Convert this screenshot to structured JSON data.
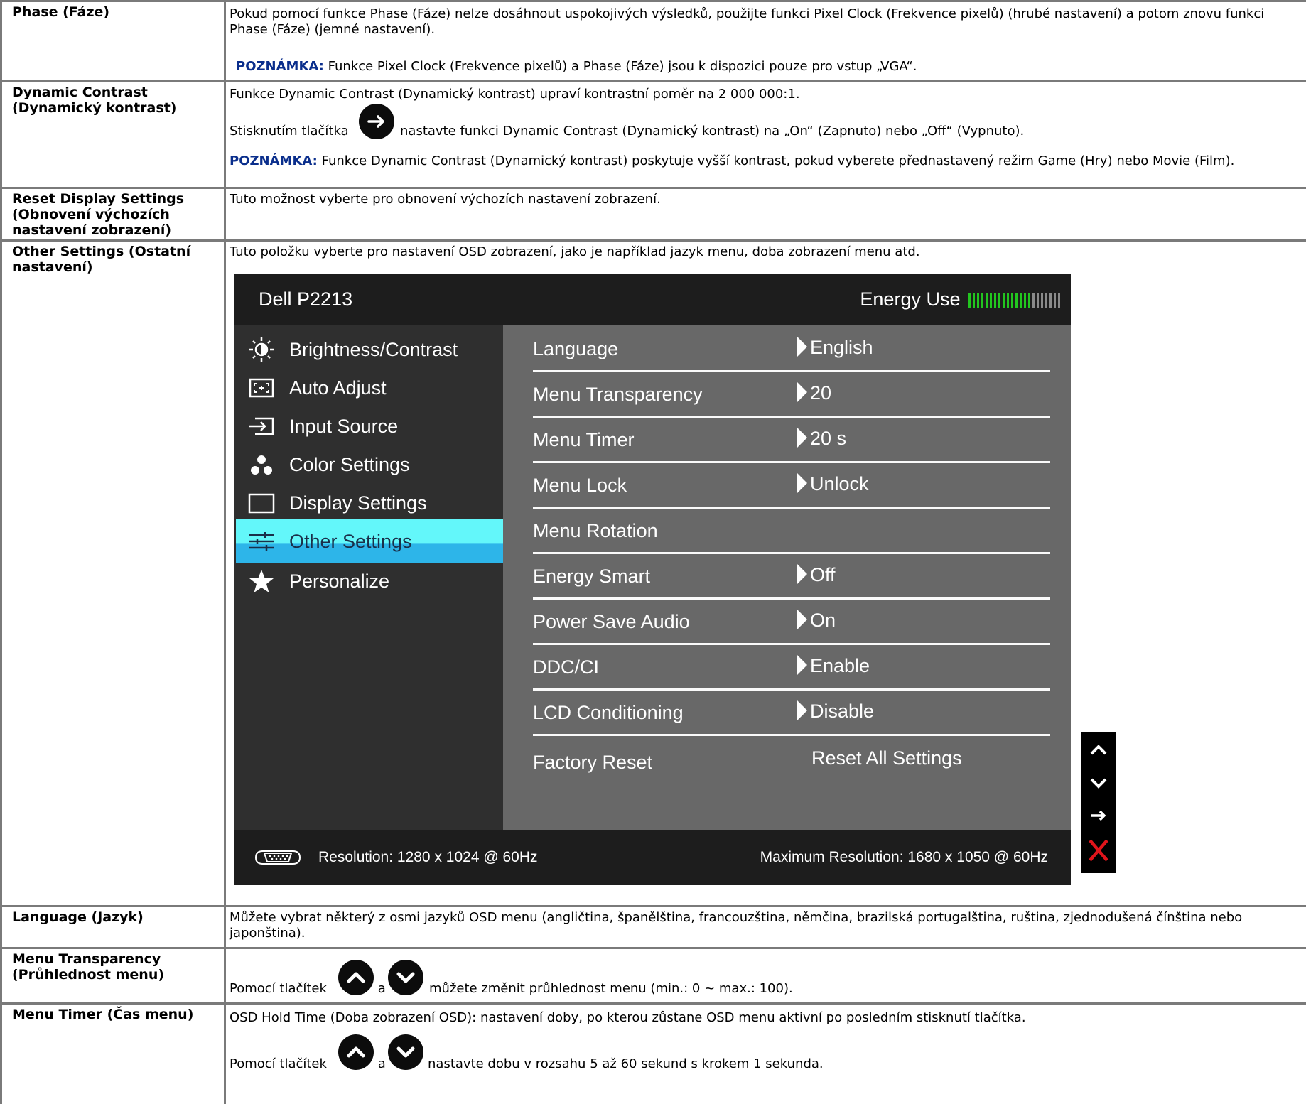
{
  "rows": {
    "phase": {
      "label": "Phase (Fáze)",
      "text1": "Pokud pomocí funkce Phase (Fáze) nelze dosáhnout uspokojivých výsledků, použijte funkci Pixel Clock (Frekvence pixelů) (hrubé nastavení) a potom znovu funkci Phase (Fáze) (jemné nastavení).",
      "note_label": "POZNÁMKA:",
      "note_text": " Funkce Pixel Clock (Frekvence pixelů) a Phase (Fáze) jsou k dispozici pouze pro vstup „VGA“."
    },
    "dynamic_contrast": {
      "label": "Dynamic Contrast (Dynamický kontrast)",
      "text1": "Funkce Dynamic Contrast (Dynamický kontrast) upraví kontrastní poměr na 2 000 000:1.",
      "text2_before": "Stisknutím tlačítka",
      "text2_after": " nastavte funkci Dynamic Contrast (Dynamický kontrast) na „On“ (Zapnuto) nebo „Off“ (Vypnuto).",
      "note_label": "POZNÁMKA:",
      "note_text": " Funkce Dynamic Contrast (Dynamický kontrast) poskytuje vyšší kontrast, pokud vyberete přednastavený režim Game (Hry) nebo Movie (Film)."
    },
    "reset_display": {
      "label": "Reset Display Settings (Obnovení výchozích nastavení zobrazení)",
      "text1": "Tuto možnost vyberte pro obnovení výchozích nastavení zobrazení."
    },
    "other_settings": {
      "label": "Other Settings (Ostatní nastavení)",
      "text1": "Tuto položku vyberte pro nastavení OSD zobrazení, jako je například jazyk menu, doba zobrazení menu atd."
    },
    "language": {
      "label": "Language (Jazyk)",
      "text1": "Můžete vybrat některý z osmi jazyků OSD menu (angličtina, španělština, francouzština, němčina, brazilská portugalština, ruština, zjednodušená čínština nebo japonština)."
    },
    "menu_transparency": {
      "label": "Menu Transparency (Průhlednost menu)",
      "text_before": "Pomocí tlačítek",
      "text_mid": " a ",
      "text_after": " můžete změnit průhlednost menu (min.: 0 ~ max.: 100)."
    },
    "menu_timer": {
      "label": "Menu Timer (Čas menu)",
      "text1": "OSD Hold Time (Doba zobrazení OSD): nastavení doby, po kterou zůstane OSD menu aktivní po posledním stisknutí tlačítka.",
      "text_before": "Pomocí tlačítek",
      "text_mid": " a ",
      "text_after": " nastavte dobu v rozsahu 5 až 60 sekund s krokem 1 sekunda."
    }
  },
  "osd": {
    "title": "Dell P2213",
    "energy_label": "Energy Use",
    "energy_level_fraction": 0.7,
    "left_menu": [
      {
        "label": "Brightness/Contrast",
        "icon": "brightness-icon"
      },
      {
        "label": "Auto Adjust",
        "icon": "auto-adjust-icon"
      },
      {
        "label": "Input Source",
        "icon": "input-source-icon"
      },
      {
        "label": "Color Settings",
        "icon": "color-settings-icon"
      },
      {
        "label": "Display Settings",
        "icon": "display-settings-icon"
      },
      {
        "label": "Other Settings",
        "icon": "other-settings-icon",
        "active": true
      },
      {
        "label": "Personalize",
        "icon": "star-icon"
      }
    ],
    "right_menu": [
      {
        "name": "Language",
        "value": "English"
      },
      {
        "name": "Menu Transparency",
        "value": "20"
      },
      {
        "name": "Menu Timer",
        "value": "20 s"
      },
      {
        "name": "Menu Lock",
        "value": "Unlock"
      },
      {
        "name": "Menu Rotation",
        "value": ""
      },
      {
        "name": "Energy Smart",
        "value": "Off"
      },
      {
        "name": "Power Save Audio",
        "value": "On"
      },
      {
        "name": "DDC/CI",
        "value": "Enable"
      },
      {
        "name": "LCD Conditioning",
        "value": "Disable"
      },
      {
        "name": "Factory Reset",
        "value": "Reset All Settings"
      }
    ],
    "footer_resolution": "Resolution: 1280 x 1024 @ 60Hz",
    "footer_max_resolution": "Maximum Resolution: 1680 x 1050 @ 60Hz"
  },
  "colors": {
    "note_blue": "#0a2e8c",
    "active_cyan": "#63f7fa",
    "energy_green": "#22c51f",
    "close_red": "#e0141b"
  }
}
